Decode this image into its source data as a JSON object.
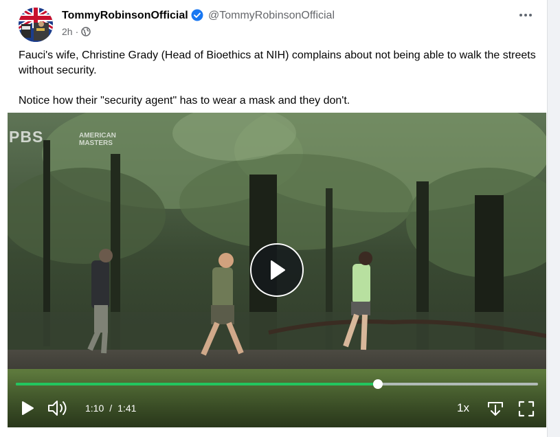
{
  "post": {
    "author_name": "TommyRobinsonOfficial",
    "handle": "@TommyRobinsonOfficial",
    "time_ago": "2h",
    "separator": "·",
    "privacy_icon": "globe-icon",
    "verified_icon": "verified-badge-icon",
    "text_paragraphs": [
      "Fauci's wife, Christine Grady (Head of Bioethics at NIH) complains about not being able to walk the streets without security.",
      "Notice how their \"security agent\" has to wear a mask and they don't."
    ]
  },
  "video": {
    "watermark": "PBS",
    "watermark_sub": [
      "AMERICAN",
      "MASTERS"
    ],
    "current_time": "1:10",
    "time_separator": "/",
    "duration": "1:41",
    "progress_fraction": 0.6935,
    "speed_label": "1x",
    "icons": {
      "play": "play-icon",
      "volume": "volume-icon",
      "download": "download-icon",
      "fullscreen": "fullscreen-icon",
      "center_play": "play-circle-icon"
    }
  },
  "colors": {
    "progress": "#22c55e",
    "verified": "#1877f2",
    "secondary_text": "#65676b"
  }
}
